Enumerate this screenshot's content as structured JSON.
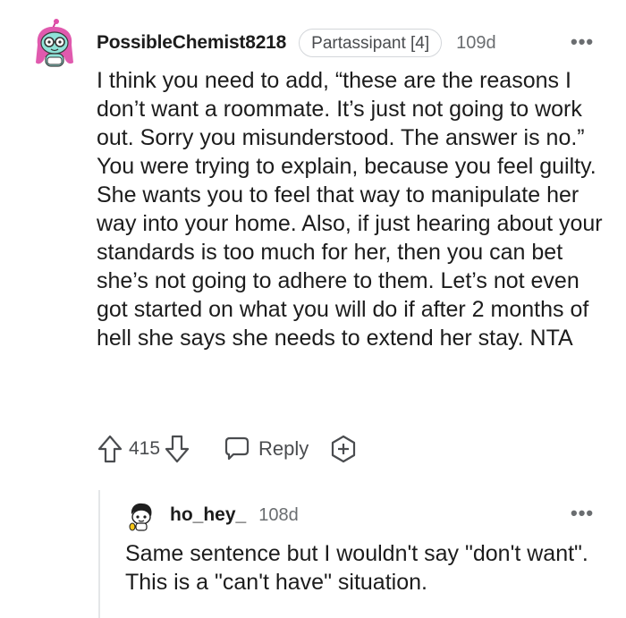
{
  "main_comment": {
    "username": "PossibleChemist8218",
    "flair": "Partassipant [4]",
    "age": "109d",
    "more": "•••",
    "body": "I think you need to add, “these are the reasons I don’t want a roommate. It’s just not going to work out. Sorry you misunderstood. The answer is no.” You were trying to explain, because you feel guilty. She wants you to feel that way to manipulate her way into your home. Also, if just hearing about your standards is too much for her, then you can bet she’s not going to adhere to them. Let’s not even got started on what you will do if after 2 months of hell she says she needs to extend her stay. NTA",
    "score": "415",
    "reply_label": "Reply"
  },
  "reply_comment": {
    "username": "ho_hey_",
    "age": "108d",
    "more": "•••",
    "body": "Same sentence but I wouldn't say \"don't want\". This is a \"can't have\" situation."
  },
  "icons": {
    "upvote": "arrow-up-icon",
    "downvote": "arrow-down-icon",
    "reply": "speech-bubble-icon",
    "award": "award-plus-icon",
    "more": "ellipsis-icon"
  },
  "colors": {
    "text": "#1c1c1c",
    "meta": "#6a6d70",
    "icon": "#4a4c4f",
    "flair_border": "#d3d6da",
    "thread_line": "#e4e6e8"
  }
}
